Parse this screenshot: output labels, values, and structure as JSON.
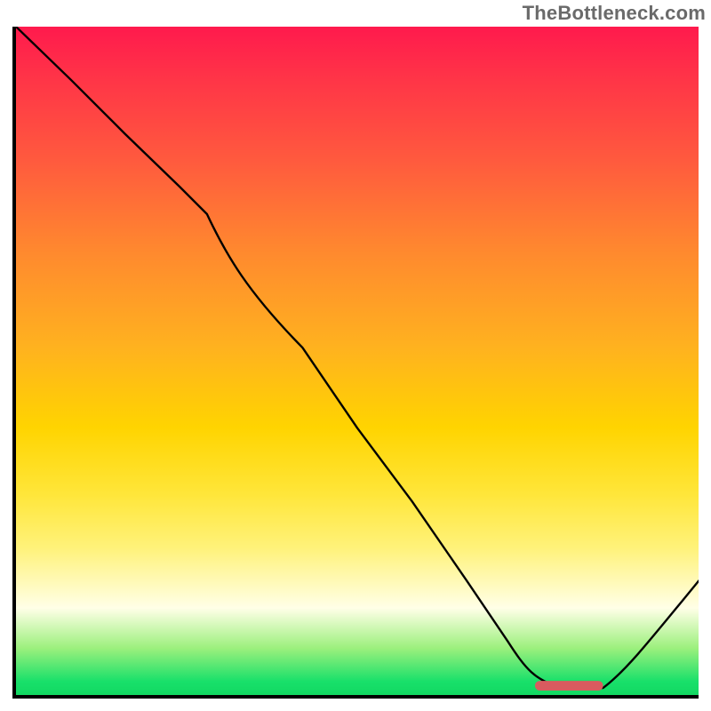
{
  "watermark": "TheBottleneck.com",
  "colors": {
    "gradient_top": "#ff1a4d",
    "gradient_mid": "#ffd400",
    "gradient_bottom": "#12d862",
    "curve": "#000000",
    "marker": "#d95b5f",
    "axis": "#000000"
  },
  "chart_data": {
    "type": "line",
    "title": "",
    "xlabel": "",
    "ylabel": "",
    "xlim": [
      0,
      100
    ],
    "ylim": [
      0,
      100
    ],
    "grid": false,
    "series": [
      {
        "name": "bottleneck-curve",
        "x": [
          0,
          8,
          16,
          24,
          28,
          34,
          42,
          50,
          58,
          66,
          72,
          76,
          80,
          84,
          86,
          92,
          100
        ],
        "values": [
          100,
          92,
          84,
          76,
          72,
          63,
          52,
          40,
          29,
          17,
          8,
          3,
          1,
          1,
          1,
          7,
          17
        ]
      }
    ],
    "annotations": [
      {
        "name": "optimal-marker",
        "shape": "rounded-bar",
        "x_range": [
          76,
          86
        ],
        "y": 1,
        "color": "#d95b5f"
      }
    ]
  }
}
